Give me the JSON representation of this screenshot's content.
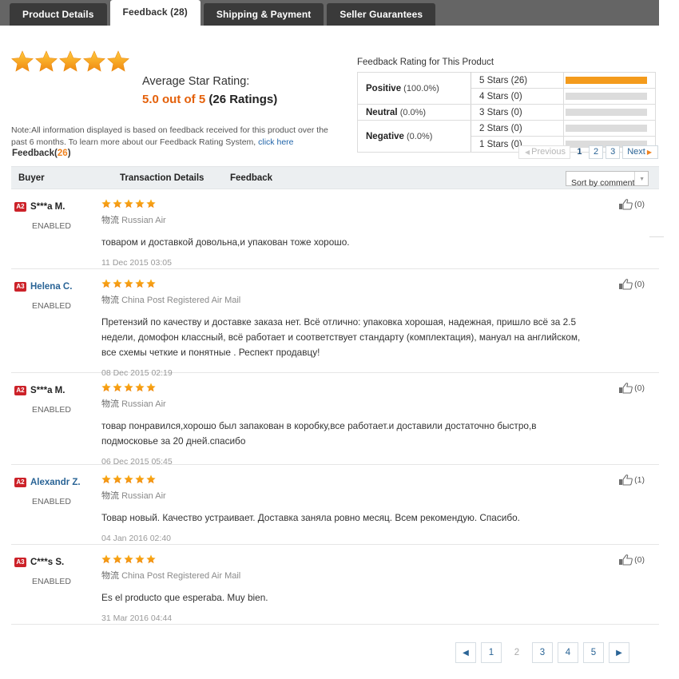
{
  "tabs": [
    {
      "label": "Product Details",
      "active": false
    },
    {
      "label": "Feedback (28)",
      "active": true
    },
    {
      "label": "Shipping & Payment",
      "active": false
    },
    {
      "label": "Seller Guarantees",
      "active": false
    }
  ],
  "summary": {
    "stars_filled": 5,
    "avg_label": "Average Star Rating:",
    "avg_score": "5.0 out of 5",
    "ratings_count": "(26 Ratings)",
    "note_text": "Note:All information displayed is based on feedback received for this product over the past 6 months. To learn more about our Feedback Rating System,",
    "note_link": "click here"
  },
  "rating_panel": {
    "title": "Feedback Rating for This Product",
    "categories": [
      {
        "label": "Positive",
        "pct": "(100.0%)",
        "span": 2
      },
      {
        "label": "Neutral",
        "pct": "(0.0%)",
        "span": 1
      },
      {
        "label": "Negative",
        "pct": "(0.0%)",
        "span": 2
      }
    ],
    "bar_color": "#f49b1c",
    "track_color": "#dcdcdc"
  },
  "chart_data": {
    "type": "bar",
    "title": "Feedback Rating for This Product",
    "categories": [
      "5 Stars",
      "4 Stars",
      "3 Stars",
      "2 Stars",
      "1 Stars"
    ],
    "values": [
      26,
      0,
      0,
      0,
      0
    ],
    "labels": [
      "5 Stars (26)",
      "4 Stars (0)",
      "3 Stars (0)",
      "2 Stars (0)",
      "1 Stars (0)"
    ],
    "bar_fill_pct": [
      100,
      0,
      0,
      0,
      0
    ],
    "groups": [
      {
        "name": "Positive",
        "pct": 100.0,
        "rows": [
          "5 Stars",
          "4 Stars"
        ]
      },
      {
        "name": "Neutral",
        "pct": 0.0,
        "rows": [
          "3 Stars"
        ]
      },
      {
        "name": "Negative",
        "pct": 0.0,
        "rows": [
          "2 Stars",
          "1 Stars"
        ]
      }
    ],
    "xlabel": "",
    "ylabel": "",
    "grid": false,
    "legend": "none",
    "total_ratings": 26,
    "average": 5.0,
    "scale_max": 5
  },
  "list": {
    "count_label": "Feedback(",
    "count_num": "26",
    "count_close": ")",
    "headers": {
      "buyer": "Buyer",
      "transaction": "Transaction Details",
      "feedback": "Feedback"
    },
    "sort": {
      "value": "Sort by comment"
    }
  },
  "pager_top": {
    "previous": "Previous",
    "pages": [
      "1",
      "2",
      "3"
    ],
    "current": "1",
    "next": "Next"
  },
  "pager_bottom": {
    "pages": [
      "1",
      "2",
      "3",
      "4",
      "5"
    ],
    "current": "2",
    "prev_icon": "◀",
    "next_icon": "▶"
  },
  "reviews": [
    {
      "badge": "A2",
      "name": "S***a M.",
      "name_is_link": false,
      "status": "ENABLED",
      "stars": 5,
      "ship_cjk": "物流",
      "ship_method": "Russian Air",
      "comment": "товаром и доставкой довольна,и упакован тоже хорошо.",
      "date": "11 Dec 2015 03:05",
      "helpful": "(0)"
    },
    {
      "badge": "A3",
      "name": "Helena C.",
      "name_is_link": true,
      "status": "ENABLED",
      "stars": 5,
      "ship_cjk": "物流",
      "ship_method": "China Post Registered Air Mail",
      "comment": "Претензий по качеству и доставке заказа нет. Всё отлично: упаковка хорошая, надежная, пришло всё за 2.5 недели, домофон классный, всё работает и соответствует стандарту (комплектация), мануал на английском, все схемы четкие и понятные . Респект продавцу!",
      "date": "08 Dec 2015 02:19",
      "helpful": "(0)"
    },
    {
      "badge": "A2",
      "name": "S***a M.",
      "name_is_link": false,
      "status": "ENABLED",
      "stars": 5,
      "ship_cjk": "物流",
      "ship_method": "Russian Air",
      "comment": "товар понравился,хорошо был запакован в коробку,все работает.и доставили достаточно быстро,в подмосковье за 20 дней.спасибо",
      "date": "06 Dec 2015 05:45",
      "helpful": "(0)"
    },
    {
      "badge": "A2",
      "name": "Alexandr Z.",
      "name_is_link": true,
      "status": "ENABLED",
      "stars": 5,
      "ship_cjk": "物流",
      "ship_method": "Russian Air",
      "comment": "Товар новый. Качество устраивает. Доставка заняла ровно месяц. Всем рекомендую. Спасибо.",
      "date": "04 Jan 2016 02:40",
      "helpful": "(1)"
    },
    {
      "badge": "A3",
      "name": "C***s S.",
      "name_is_link": false,
      "status": "ENABLED",
      "stars": 5,
      "ship_cjk": "物流",
      "ship_method": "China Post Registered Air Mail",
      "comment": "Es el producto que esperaba. Muy bien.",
      "date": "31 Mar 2016 04:44",
      "helpful": "(0)"
    }
  ],
  "colors": {
    "accent_orange": "#f0821e",
    "star_orange": "#f6a01a",
    "link_blue": "#2a6496",
    "badge_red": "#cc2229",
    "score_red": "#e4393c",
    "tabbar_grey": "#656565",
    "tab_dark": "#3a3a3a"
  }
}
